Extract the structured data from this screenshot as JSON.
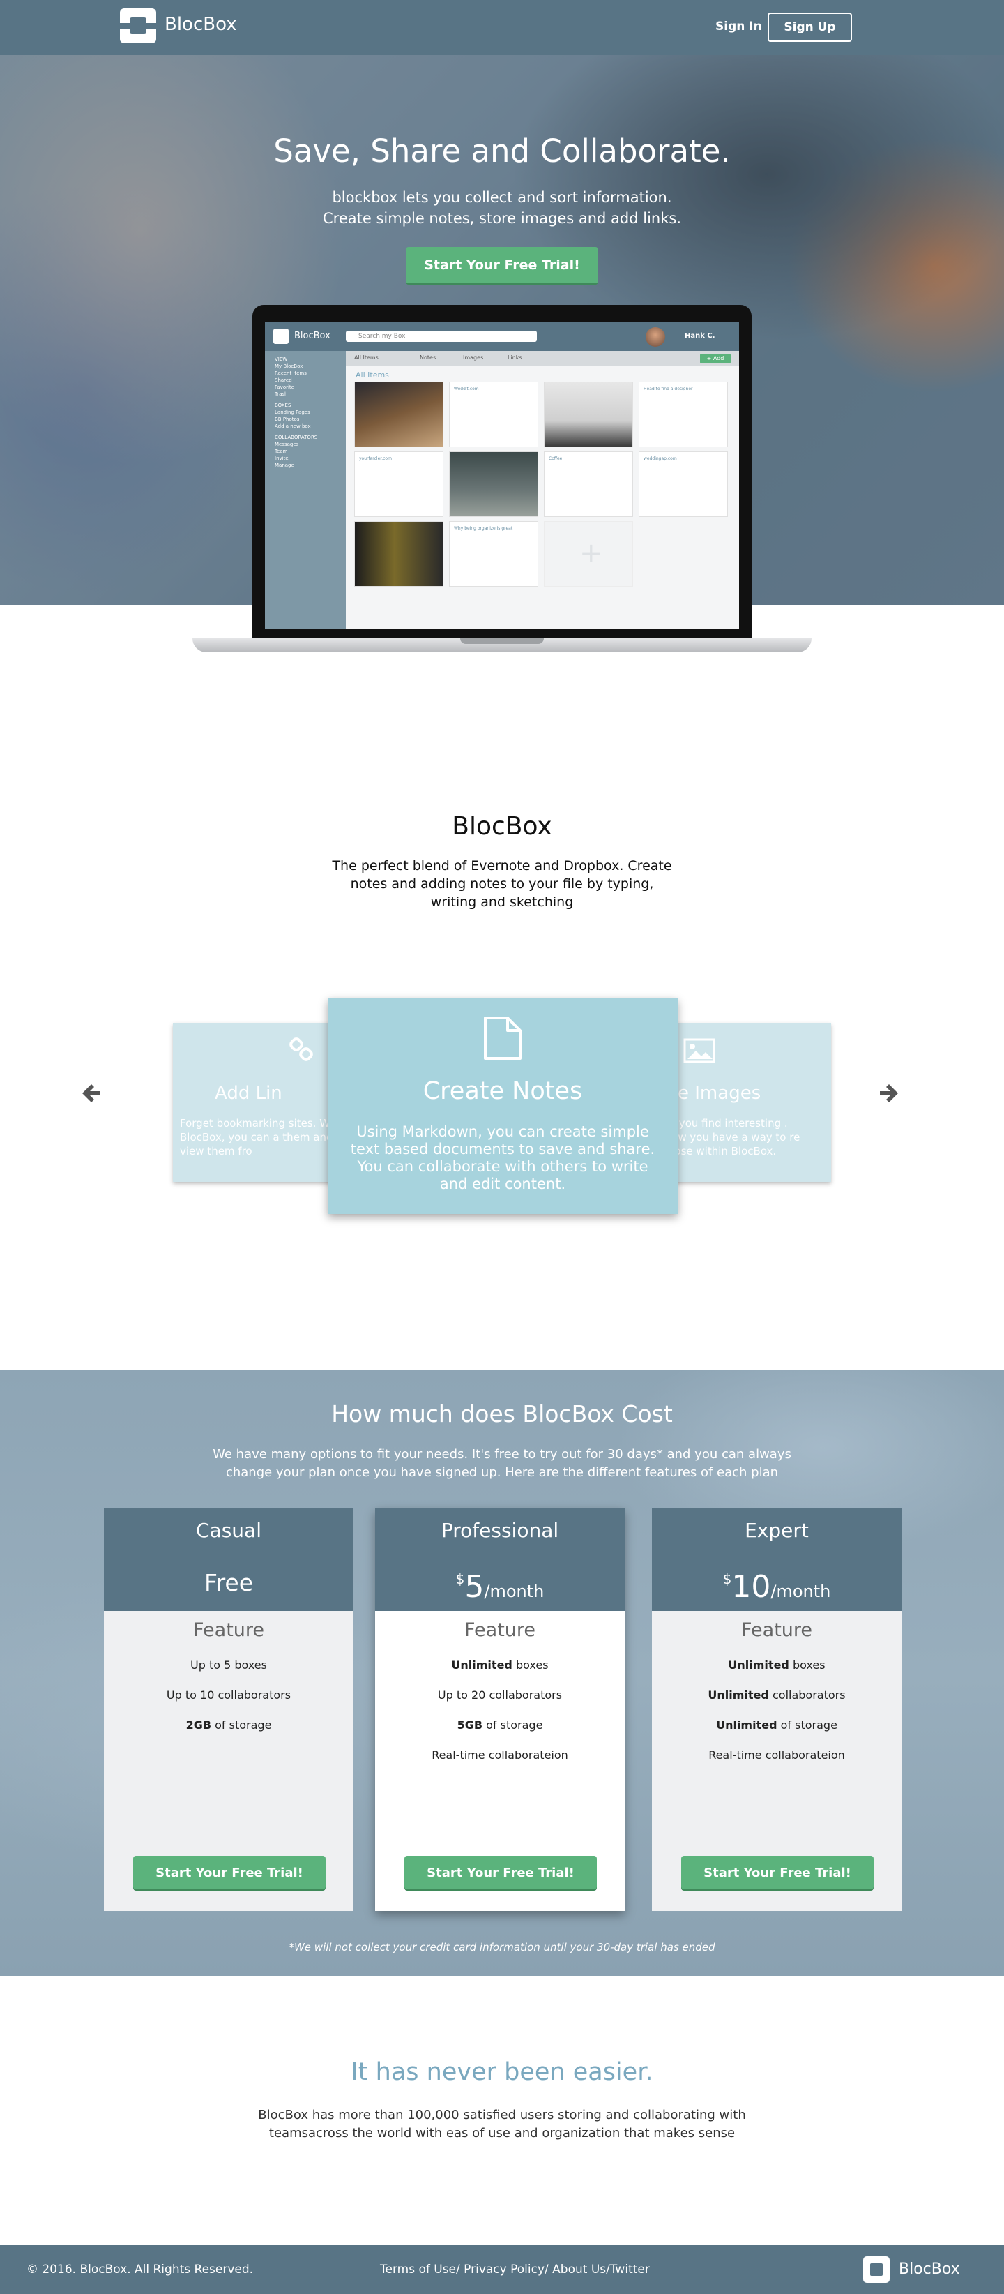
{
  "nav": {
    "brand": "BlocBox",
    "sign_in": "Sign In",
    "sign_up": "Sign Up"
  },
  "hero": {
    "title": "Save, Share and Collaborate.",
    "subtitle_line1": "blockbox lets you collect and sort information.",
    "subtitle_line2": "Create simple notes, store images and add links.",
    "cta": "Start Your Free Trial!"
  },
  "app_preview": {
    "brand": "BlocBox",
    "search_placeholder": "Search my Box",
    "user": "Hank C.",
    "sidebar": [
      "VIEW",
      "My BlocBox",
      "Recent items",
      "Shared",
      "Favorite",
      "Trash",
      "BOXES",
      "Landing Pages",
      "BB Photos",
      "Add a new box",
      "COLLABORATORS",
      "Messages",
      "Team",
      "Invite",
      "Manage"
    ],
    "tabs": [
      "All Items",
      "Notes",
      "Images",
      "Links"
    ],
    "add_button": "+ Add",
    "section_label": "All Items",
    "card_texts": [
      "Weddit.com",
      "Head to find a designer",
      "yourfarcler.com",
      "Coffee",
      "weddingap.com",
      "Why being organize is great"
    ]
  },
  "intro": {
    "title": "BlocBox",
    "text": "The perfect blend of Evernote and Dropbox. Create notes and adding notes to your file by typing, writing and sketching"
  },
  "carousel": {
    "prev_icon": "chevron-left-icon",
    "next_icon": "chevron-right-icon",
    "left_card": {
      "title": "Add Lin",
      "desc": "Forget bookmarking sites. With BlocBox, you can a them and view them fro"
    },
    "center_card": {
      "title": "Create Notes",
      "desc": "Using Markdown, you can create simple text based documents to save and share. You can collaborate with others to write and edit content."
    },
    "right_card": {
      "title": "e Images",
      "desc": "es you find interesting . Now you have a way to re those within BlocBox."
    }
  },
  "pricing": {
    "title": "How much does BlocBox Cost",
    "subtitle": "We have many options to fit your needs. It's free to try out for 30 days* and you can always change your plan once you have signed up. Here are the different features of each plan",
    "feature_heading": "Feature",
    "cta": "Start Your Free Trial!",
    "note": "*We will not collect your credit card information until your 30-day trial has ended",
    "plans": [
      {
        "name": "Casual",
        "price": "Free",
        "features": [
          {
            "bold": "",
            "text": "Up to 5 boxes"
          },
          {
            "bold": "",
            "text": "Up to 10 collaborators"
          },
          {
            "bold": "2GB",
            "text": " of storage"
          }
        ]
      },
      {
        "name": "Professional",
        "currency": "$",
        "amount": "5",
        "period": "/month",
        "features": [
          {
            "bold": "Unlimited",
            "text": " boxes"
          },
          {
            "bold": "",
            "text": "Up to 20 collaborators"
          },
          {
            "bold": "5GB",
            "text": " of storage"
          },
          {
            "bold": "",
            "text": "Real-time collaborateion"
          }
        ]
      },
      {
        "name": "Expert",
        "currency": "$",
        "amount": "10",
        "period": "/month",
        "features": [
          {
            "bold": "Unlimited",
            "text": " boxes"
          },
          {
            "bold": "Unlimited",
            "text": " collaborators"
          },
          {
            "bold": "Unlimited",
            "text": " of storage"
          },
          {
            "bold": "",
            "text": "Real-time collaborateion"
          }
        ]
      }
    ]
  },
  "easier": {
    "title": "It has never been easier.",
    "text": "BlocBox has more than 100,000 satisfied users storing and collaborating with teamsacross the world with eas of use and organization that makes sense"
  },
  "footer": {
    "copyright": "© 2016. BlocBox. All Rights Reserved.",
    "terms": "Terms of Use/",
    "privacy": " Privacy Policy/",
    "about": " About Us/",
    "twitter": "Twitter",
    "brand": "BlocBox"
  },
  "colors": {
    "primary": "#587485",
    "accent_green": "#5bb37c",
    "card_light": "#cfe5eb",
    "card_active": "#a7d3dd",
    "heading_blue": "#7aa8bf"
  }
}
